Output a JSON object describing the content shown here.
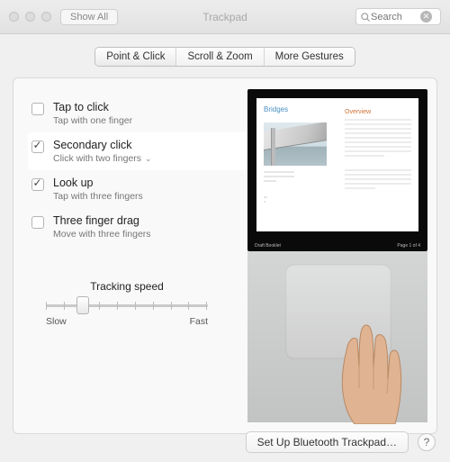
{
  "window": {
    "title": "Trackpad",
    "show_all": "Show All",
    "search_placeholder": "Search"
  },
  "tabs": {
    "t0": "Point & Click",
    "t1": "Scroll & Zoom",
    "t2": "More Gestures",
    "selected_index": 0
  },
  "options": [
    {
      "title": "Tap to click",
      "sub": "Tap with one finger",
      "checked": false,
      "selected": false,
      "has_menu": false
    },
    {
      "title": "Secondary click",
      "sub": "Click with two fingers",
      "checked": true,
      "selected": true,
      "has_menu": true
    },
    {
      "title": "Look up",
      "sub": "Tap with three fingers",
      "checked": true,
      "selected": false,
      "has_menu": false
    },
    {
      "title": "Three finger drag",
      "sub": "Move with three fingers",
      "checked": false,
      "selected": false,
      "has_menu": false
    }
  ],
  "slider": {
    "title": "Tracking speed",
    "low": "Slow",
    "high": "Fast",
    "ticks": 10,
    "position_index": 2
  },
  "preview": {
    "doc_title": "Bridges",
    "section_title": "Overview",
    "footer_left": "Draft Booklet",
    "footer_right": "Page 1 of 4"
  },
  "bottom": {
    "button": "Set Up Bluetooth Trackpad…",
    "help": "?"
  }
}
